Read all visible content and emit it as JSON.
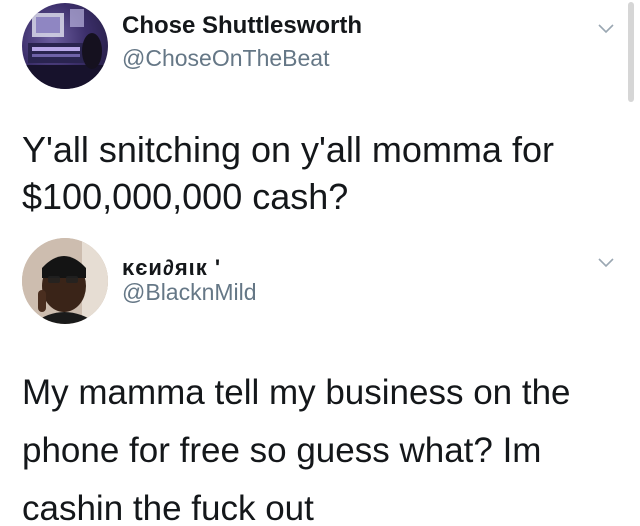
{
  "tweets": [
    {
      "display_name": "Chose Shuttlesworth",
      "handle": "@ChoseOnTheBeat",
      "text": "Y'all snitching on y'all momma for $100,000,000 cash?",
      "avatar_icon": "user-avatar-studio",
      "menu_icon": "chevron-down-icon"
    },
    {
      "display_name": "κєи∂яιк '",
      "handle": "@BlacknMild",
      "text": "My mamma tell my business on the phone for free so guess what? Im cashin the fuck out",
      "avatar_icon": "user-avatar-portrait",
      "menu_icon": "chevron-down-icon"
    }
  ],
  "colors": {
    "text": "#14171a",
    "secondary": "#657786",
    "caret": "#9aa7b2"
  }
}
